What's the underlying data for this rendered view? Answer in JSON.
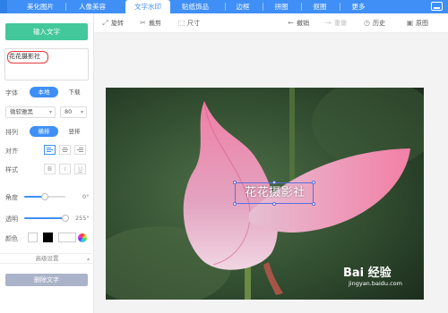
{
  "tabs": [
    {
      "label": "美化图片",
      "active": false
    },
    {
      "label": "人像美容",
      "active": false
    },
    {
      "label": "文字水印",
      "active": true
    },
    {
      "label": "贴纸饰品",
      "active": false
    },
    {
      "label": "边框",
      "active": false
    },
    {
      "label": "拼图",
      "active": false
    },
    {
      "label": "抠图",
      "active": false
    },
    {
      "label": "更多",
      "active": false
    }
  ],
  "toolbar": {
    "rotate": "旋转",
    "crop": "裁剪",
    "size": "尺寸",
    "undo": "撤销",
    "redo": "重做",
    "history": "历史",
    "original": "原图"
  },
  "panel": {
    "input_button": "输入文字",
    "text_value": "花花摄影社",
    "font_label": "字体",
    "font_source_local": "本地",
    "font_source_download": "下载",
    "font_family": "微软雅黑",
    "font_size": "80",
    "layout_label": "排列",
    "layout_horizontal": "横排",
    "layout_vertical": "竖排",
    "align_label": "对齐",
    "style_label": "样式",
    "style_bold": "B",
    "style_italic": "I",
    "style_underline": "U",
    "angle_label": "角度",
    "angle_value": "0°",
    "angle_level": 0.5,
    "opacity_label": "透明",
    "opacity_value": "255°",
    "opacity_level": 1.0,
    "color_label": "颜色",
    "advanced": "高级设置",
    "delete_button": "删除文字"
  },
  "canvas": {
    "watermark_text": "花花摄影社",
    "brand": "Bai 经验",
    "brand_url": "jingyan.baidu.com"
  },
  "colors": {
    "accent": "#3f8ff7",
    "primary_button": "#42c89a",
    "delete_button": "#aab3c9",
    "annotation": "#e23b3b"
  }
}
